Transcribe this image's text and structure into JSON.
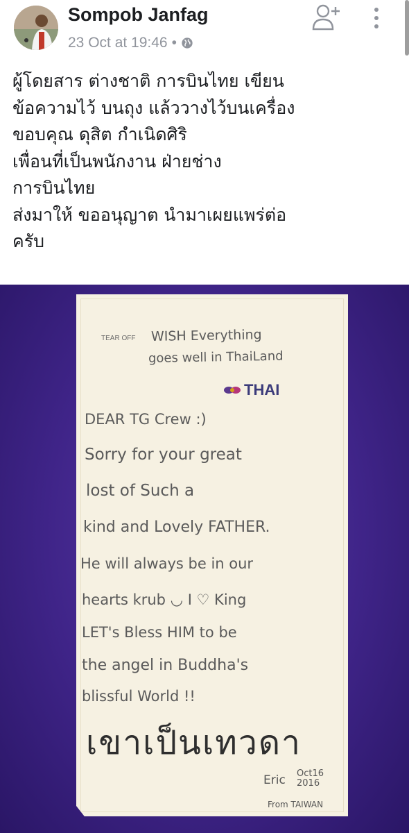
{
  "post": {
    "author": "Sompob Janfag",
    "timestamp": "23 Oct at 19:46",
    "separator": "•",
    "text_lines": [
      "ผู้โดยสาร ต่างชาติ การบินไทย  เขียน",
      "ข้อความไว้ บนถุง แล้ววางไว้บนเครื่อง",
      "ขอบคุณ  ดุสิต กำเนิดศิริ",
      "เพื่อนที่เป็นพนักงาน ฝ่ายช่าง",
      "การบินไทย",
      "ส่งมาให้ ขออนุญาต นำมาเผยแพร่ต่อ",
      "ครับ"
    ]
  },
  "icons": {
    "add_friend": "add-friend-icon",
    "more": "more-vertical-icon",
    "privacy": "globe-icon"
  },
  "photo": {
    "printed": {
      "tear_off": "TEAR OFF",
      "brand": "THAI"
    },
    "note_lines": [
      "WISH Everything",
      "goes well in ThaiLand",
      "DEAR TG Crew :)",
      "Sorry for your great",
      "lost of Such a",
      "kind and Lovely FATHER.",
      "He will always be in our",
      "hearts krub ◡ I ♡ King",
      "LET's Bless HIM to be",
      "the angel in Buddha's",
      "blissful World !!"
    ],
    "thai_script": "เขาเป็นเทวดา",
    "signature": "Eric",
    "signature_date": [
      "Oct16",
      "2016"
    ],
    "signature_from": "From TAIWAN"
  },
  "colors": {
    "background_purple": "#3f2488",
    "bag": "#f6f1e2",
    "meta_gray": "#90949c"
  }
}
